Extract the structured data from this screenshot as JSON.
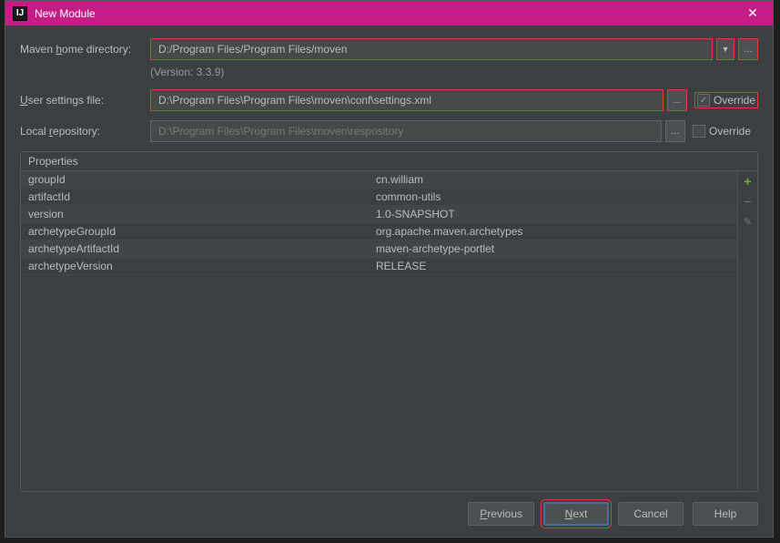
{
  "titlebar": {
    "title": "New Module"
  },
  "form": {
    "maven_home": {
      "label_pre": "Maven ",
      "label_u": "h",
      "label_post": "ome directory:",
      "value": "D:/Program Files/Program Files/moven"
    },
    "version": "(Version: 3.3.9)",
    "user_settings": {
      "label_u": "U",
      "label_post": "ser settings file:",
      "value": "D:\\Program Files\\Program Files\\moven\\conf\\settings.xml",
      "override_label": "Override",
      "override_checked": "✓"
    },
    "local_repo": {
      "label_pre": "Local ",
      "label_u": "r",
      "label_post": "epository:",
      "value": "D:\\Program Files\\Program Files\\moven\\respository",
      "override_label": "Override"
    }
  },
  "properties": {
    "title": "Properties",
    "rows": [
      {
        "name": "groupId",
        "value": "cn.william"
      },
      {
        "name": "artifactId",
        "value": "common-utils"
      },
      {
        "name": "version",
        "value": "1.0-SNAPSHOT"
      },
      {
        "name": "archetypeGroupId",
        "value": "org.apache.maven.archetypes"
      },
      {
        "name": "archetypeArtifactId",
        "value": "maven-archetype-portlet"
      },
      {
        "name": "archetypeVersion",
        "value": "RELEASE"
      }
    ]
  },
  "buttons": {
    "previous": {
      "u": "P",
      "rest": "revious"
    },
    "next": {
      "u": "N",
      "rest": "ext"
    },
    "cancel": "Cancel",
    "help": "Help"
  },
  "icons": {
    "plus": "+",
    "minus": "−",
    "edit": "✎",
    "dropdown": "▼",
    "ellipsis": "...",
    "close": "✕"
  }
}
